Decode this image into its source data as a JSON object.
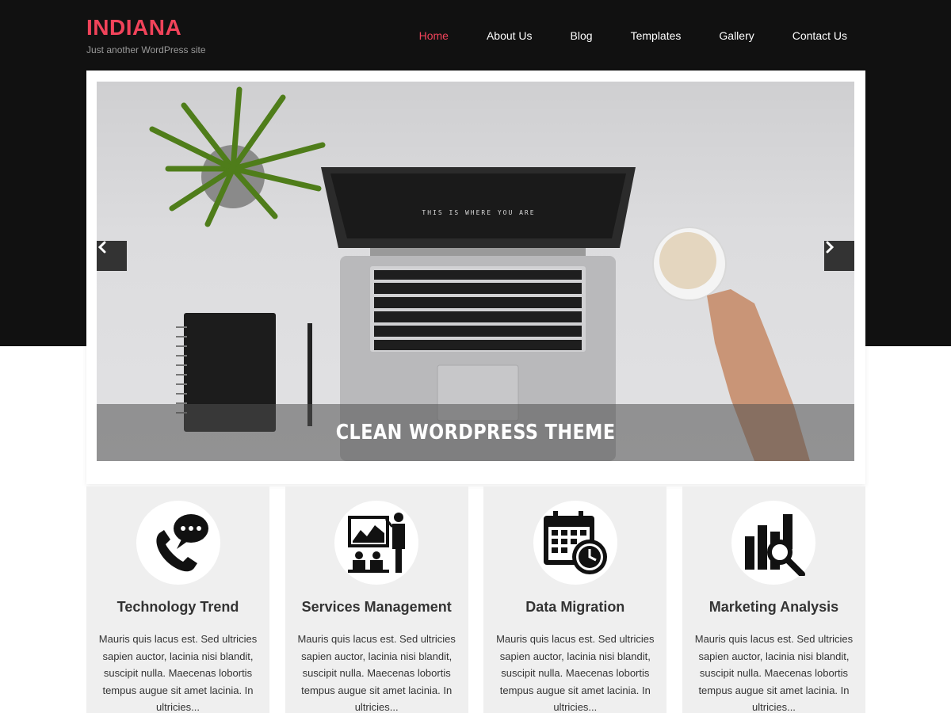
{
  "site": {
    "title": "INDIANA",
    "tagline": "Just another WordPress site",
    "accent_color": "#f1435a"
  },
  "nav": {
    "items": [
      {
        "label": "Home",
        "active": true
      },
      {
        "label": "About Us",
        "active": false
      },
      {
        "label": "Blog",
        "active": false
      },
      {
        "label": "Templates",
        "active": false
      },
      {
        "label": "Gallery",
        "active": false
      },
      {
        "label": "Contact Us",
        "active": false
      }
    ]
  },
  "slider": {
    "caption": "CLEAN WORDPRESS THEME",
    "prev_icon": "chevron-left-icon",
    "next_icon": "chevron-right-icon",
    "laptop_screen_text": "THIS IS WHERE YOU ARE"
  },
  "features": [
    {
      "icon": "phone-chat-icon",
      "title": "Technology Trend",
      "text": "Mauris quis lacus est. Sed ultricies sapien auctor, lacinia nisi blandit, suscipit nulla. Maecenas lobortis tempus augue sit amet lacinia. In ultricies..."
    },
    {
      "icon": "presentation-icon",
      "title": "Services Management",
      "text": "Mauris quis lacus est. Sed ultricies sapien auctor, lacinia nisi blandit, suscipit nulla. Maecenas lobortis tempus augue sit amet lacinia. In ultricies..."
    },
    {
      "icon": "calendar-clock-icon",
      "title": "Data Migration",
      "text": "Mauris quis lacus est. Sed ultricies sapien auctor, lacinia nisi blandit, suscipit nulla. Maecenas lobortis tempus augue sit amet lacinia. In ultricies..."
    },
    {
      "icon": "chart-magnifier-icon",
      "title": "Marketing Analysis",
      "text": "Mauris quis lacus est. Sed ultricies sapien auctor, lacinia nisi blandit, suscipit nulla. Maecenas lobortis tempus augue sit amet lacinia. In ultricies..."
    }
  ]
}
